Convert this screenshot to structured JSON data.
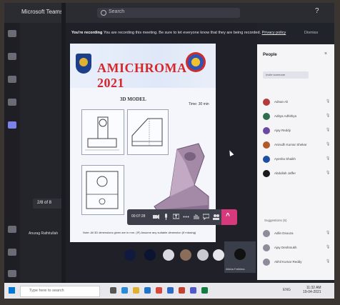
{
  "window": {
    "app_title": "Microsoft Teams",
    "search_placeholder": "Search",
    "help": "?"
  },
  "recording_banner": {
    "bold": "You're recording",
    "text": "You are recording this meeting. Be sure to let everyone know that they are being recorded.",
    "link": "Privacy policy",
    "dismiss": "Dismiss"
  },
  "left_panel": {
    "mini_controls": "2/8 of 8",
    "team_name": "Anurag Rathitullah"
  },
  "slide": {
    "title": "AMICHROMA 2021",
    "subtitle": "3D MODEL",
    "time": "Time: 30 min",
    "note": "Note: All 3D dimensions given are in mm. (IF) Assume any suitable dimension (If missing)"
  },
  "controls": {
    "timer": "00:07:28",
    "leave": "^"
  },
  "self_view": {
    "name": "Alisha Fathima"
  },
  "people": {
    "title": "People",
    "invite": "Invite someone",
    "participants": [
      {
        "name": "Adnan Ali",
        "color": "#b43b3b"
      },
      {
        "name": "Aditya Adhithya",
        "color": "#2e6e4b"
      },
      {
        "name": "Ajay Reddy",
        "color": "#6a4aa0"
      },
      {
        "name": "Anirudh Kumar Shekar",
        "color": "#b05a2a"
      },
      {
        "name": "Ayesha Shaikh",
        "color": "#1c4fa0"
      },
      {
        "name": "Abdullah Jaffer",
        "color": "#1a1a1a"
      }
    ],
    "others_label": "Suggestions (5)",
    "others": [
      {
        "name": "Adlin Dsouza",
        "color": "#8c8c9a"
      },
      {
        "name": "Ajay Deshmukh",
        "color": "#8c8c9a"
      },
      {
        "name": "Akhil Kumar Reddy",
        "color": "#8c8c9a"
      }
    ]
  },
  "taskbar": {
    "search_placeholder": "Type here to search",
    "time": "11:32 AM",
    "date": "19-04-2021",
    "lang": "ENG"
  }
}
